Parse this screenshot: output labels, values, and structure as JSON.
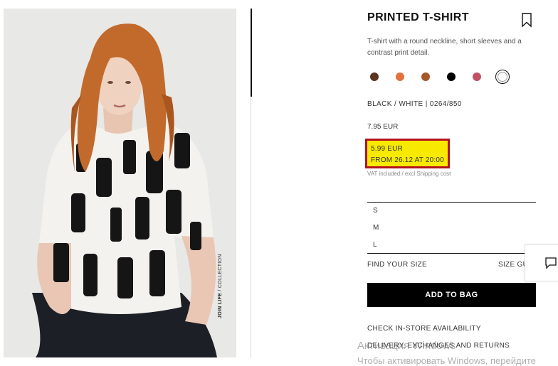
{
  "product": {
    "photo_label_bold": "JOIN LIFE",
    "photo_label_rest": " / COLLECTION",
    "title": "PRINTED T-SHIRT",
    "description": "T-shirt with a round neckline, short sleeves and a contrast print detail.",
    "colors": [
      {
        "name": "dark-brown",
        "hex": "#5a3520"
      },
      {
        "name": "orange",
        "hex": "#e2733c"
      },
      {
        "name": "brown",
        "hex": "#a5582c"
      },
      {
        "name": "black",
        "hex": "#000000"
      },
      {
        "name": "rose",
        "hex": "#c25263"
      },
      {
        "name": "white",
        "hex": "#ffffff",
        "selected": true
      }
    ],
    "color_code": "BLACK / WHITE | 0264/850",
    "old_price": "7.95 EUR",
    "promo": {
      "price": "5.99 EUR",
      "note": "FROM 26.12 AT 20:00",
      "highlight": "#f7ea00",
      "border": "#b3131c"
    },
    "vat_note": "VAT included / excl Shipping cost",
    "sizes": [
      "S",
      "M",
      "L"
    ],
    "find_your_size": "FIND YOUR SIZE",
    "size_guide": "SIZE GU",
    "add_to_bag": "ADD TO BAG",
    "check_store": "CHECK IN-STORE AVAILABILITY",
    "delivery": "DELIVERY, EXCHANGES AND RETURNS"
  },
  "watermark": {
    "line1": "Активация Windows",
    "line2": "Чтобы активировать Windows, перейдите"
  }
}
